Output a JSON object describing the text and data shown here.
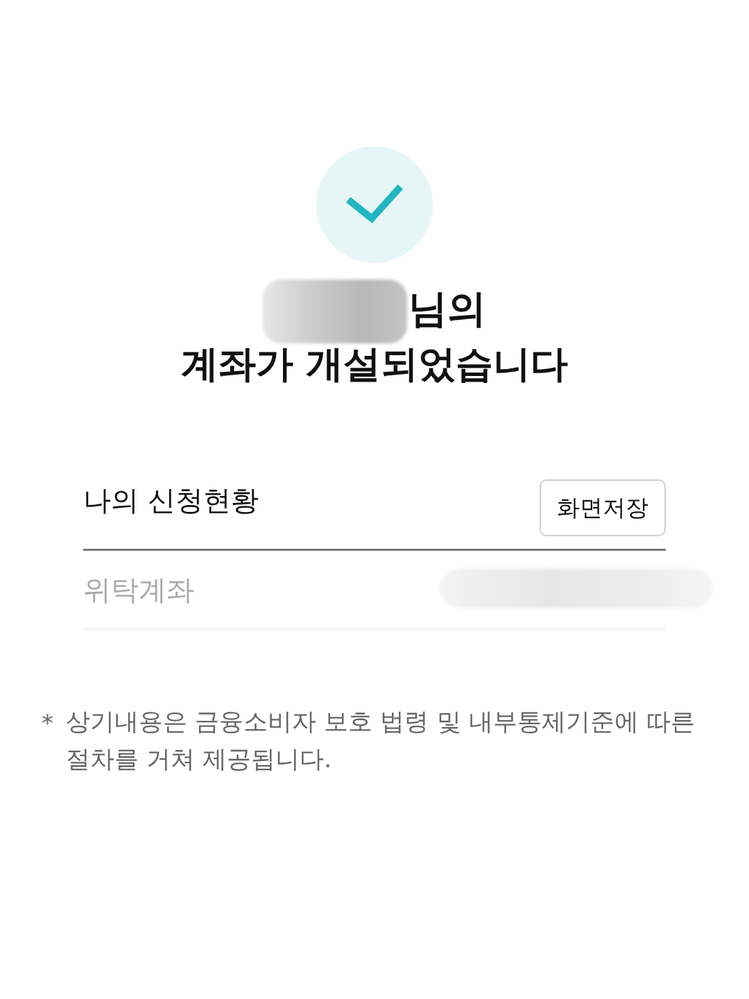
{
  "status_icon": {
    "kind": "success"
  },
  "title": {
    "name_redacted": true,
    "line_1": "님의",
    "line_2": "계좌가 개설되었습니다"
  },
  "summary": {
    "heading": "나의 신청현황",
    "save_button": "화면저장",
    "rows": [
      {
        "label": "위탁계좌",
        "value_redacted": true
      }
    ]
  },
  "note": {
    "marker": "*",
    "text": "상기내용은 금융소비자 보호 법령 및 내부통제기준에 따른 절차를 거쳐 제공됩니다."
  }
}
